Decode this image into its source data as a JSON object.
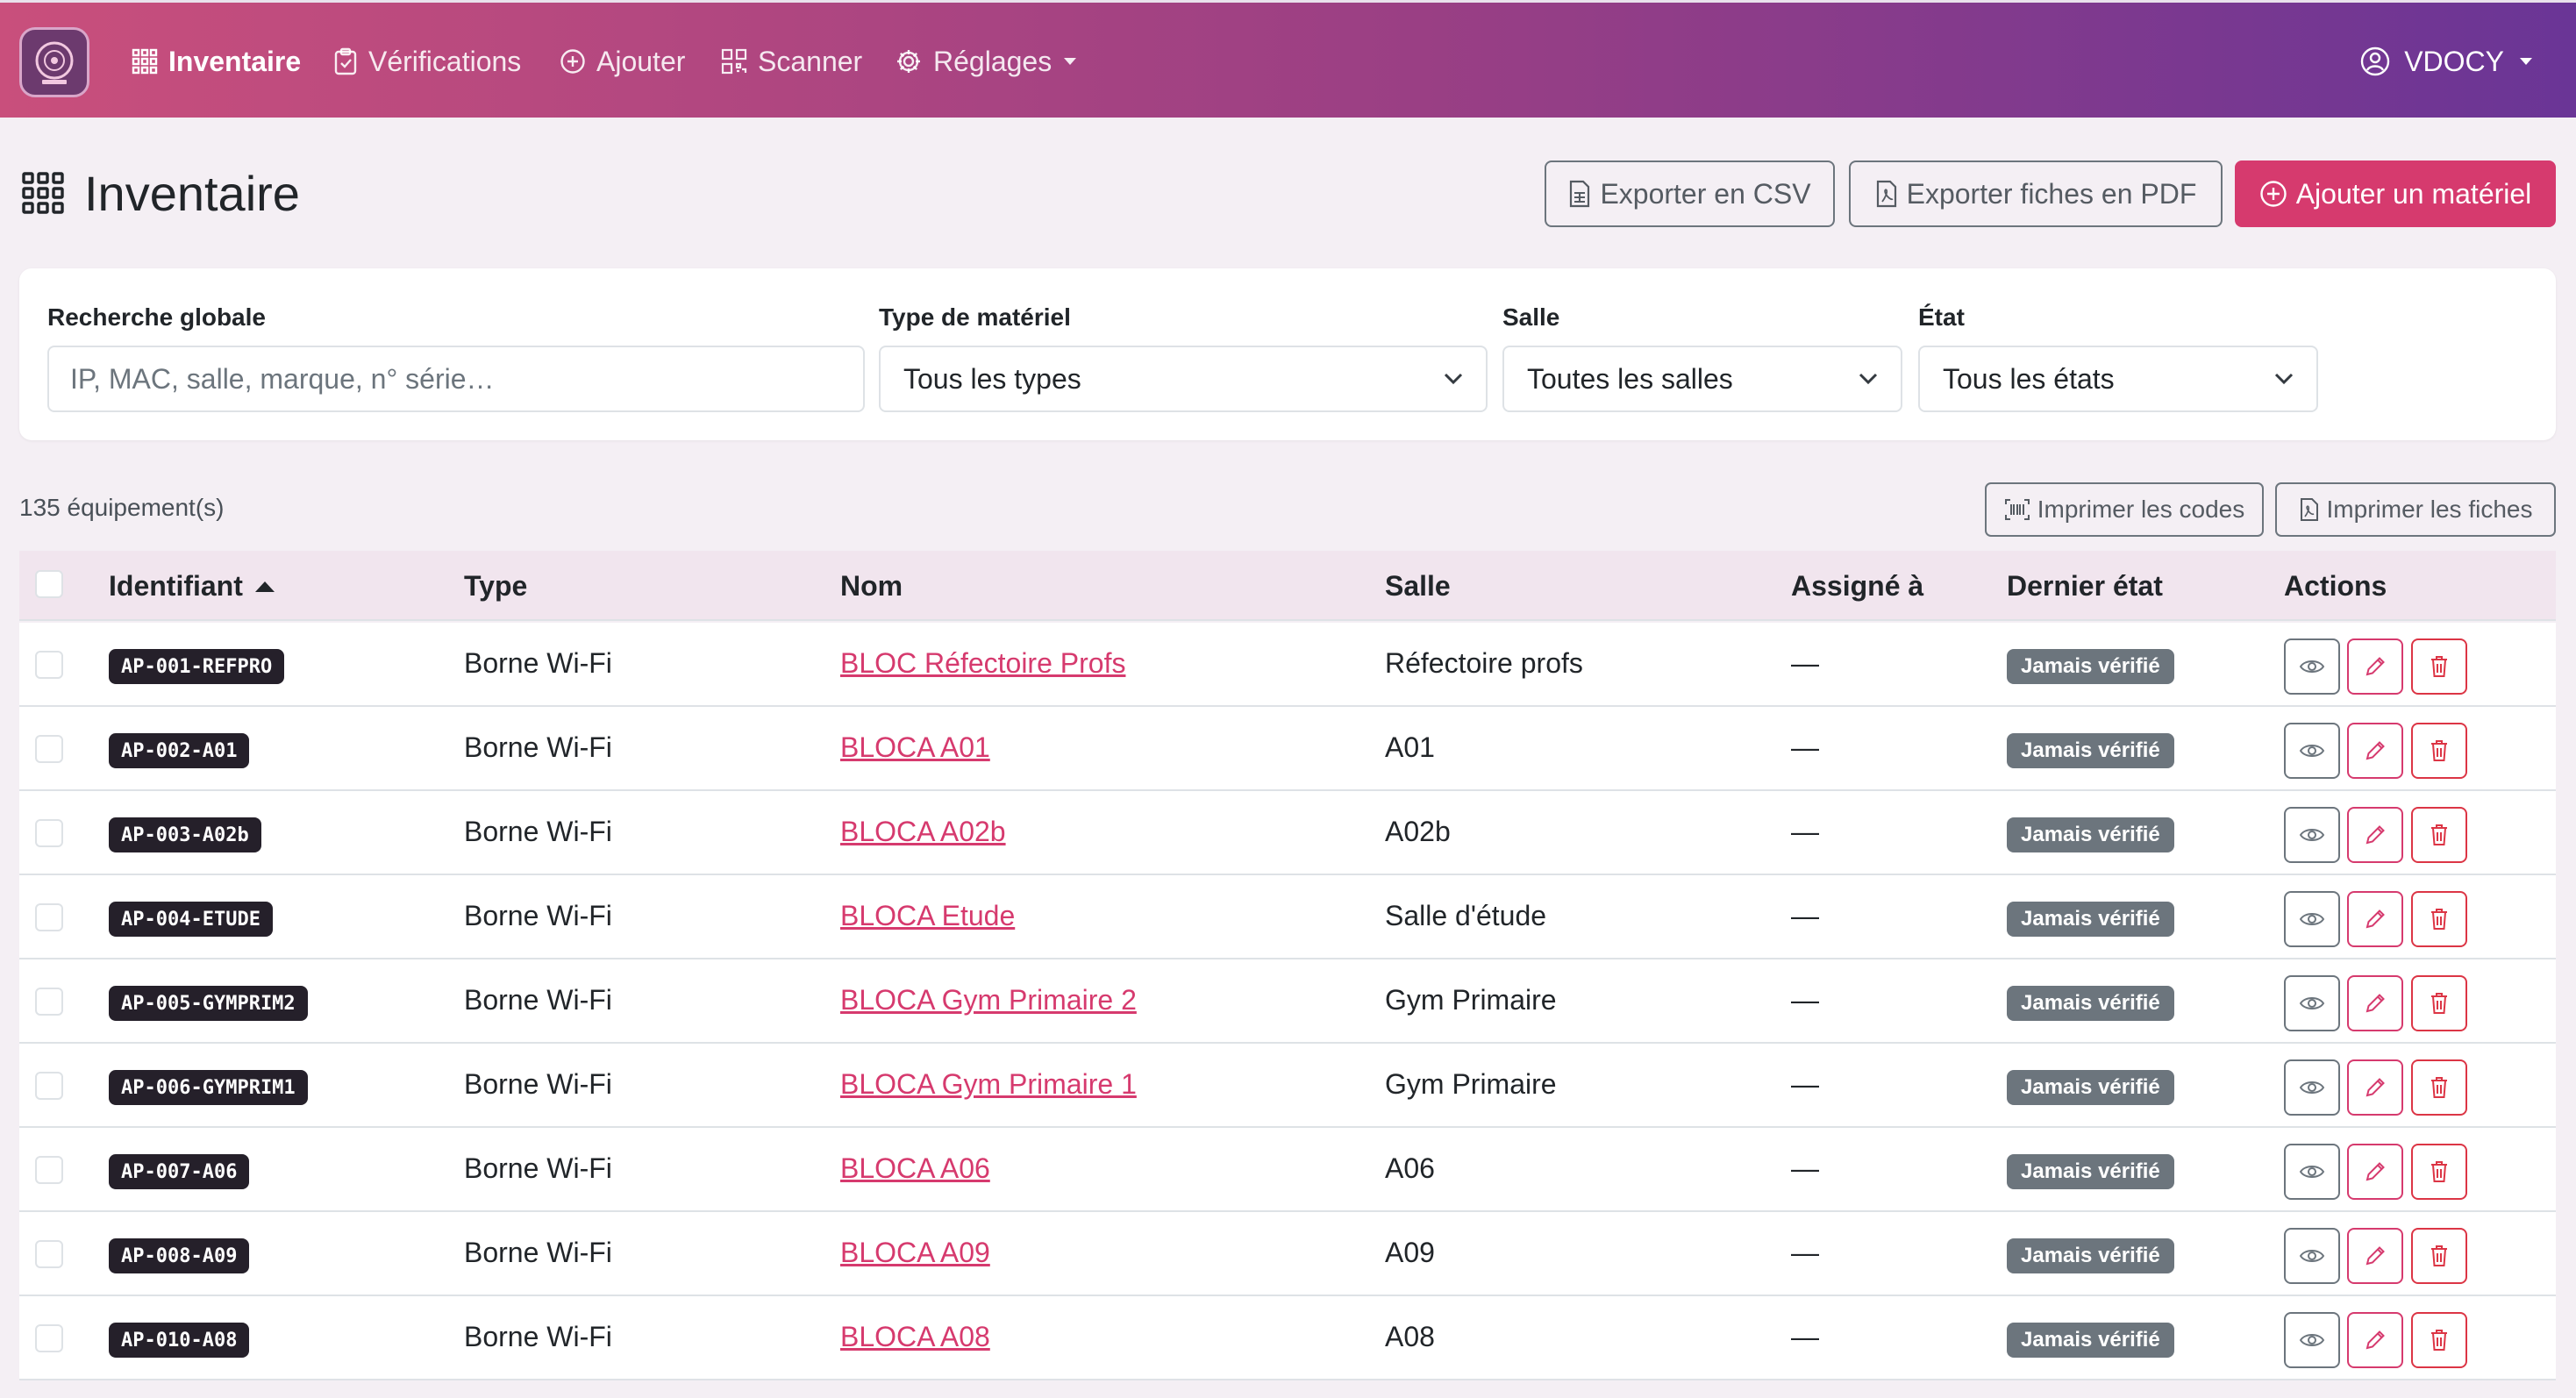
{
  "navbar": {
    "logo_alt": "EQUIPAUL",
    "items": [
      {
        "label": "Inventaire",
        "icon": "grid-icon",
        "active": true
      },
      {
        "label": "Vérifications",
        "icon": "clipboard-check-icon"
      },
      {
        "label": "Ajouter",
        "icon": "plus-circle-icon"
      },
      {
        "label": "Scanner",
        "icon": "qr-code-icon"
      },
      {
        "label": "Réglages",
        "icon": "gear-icon"
      }
    ],
    "user": "VDOCY"
  },
  "page": {
    "title": "Inventaire",
    "export_csv": "Exporter en CSV",
    "export_pdf": "Exporter fiches en PDF",
    "add_material": "Ajouter un matériel"
  },
  "filters": {
    "search_label": "Recherche globale",
    "search_placeholder": "IP, MAC, salle, marque, n° série…",
    "type_label": "Type de matériel",
    "type_value": "Tous les types",
    "room_label": "Salle",
    "room_value": "Toutes les salles",
    "state_label": "État",
    "state_value": "Tous les états"
  },
  "list": {
    "count": "135 équipement(s)",
    "print_codes": "Imprimer les codes",
    "print_sheets": "Imprimer les fiches"
  },
  "table": {
    "columns": {
      "id": "Identifiant",
      "type": "Type",
      "name": "Nom",
      "room": "Salle",
      "assigned": "Assigné à",
      "state": "Dernier état",
      "actions": "Actions"
    },
    "rows": [
      {
        "id": "AP-001-REFPRO",
        "type": "Borne Wi-Fi",
        "name": "BLOC Réfectoire Profs",
        "room": "Réfectoire profs",
        "assigned": "—",
        "state": "Jamais vérifié"
      },
      {
        "id": "AP-002-A01",
        "type": "Borne Wi-Fi",
        "name": "BLOCA A01",
        "room": "A01",
        "assigned": "—",
        "state": "Jamais vérifié"
      },
      {
        "id": "AP-003-A02b",
        "type": "Borne Wi-Fi",
        "name": "BLOCA A02b",
        "room": "A02b",
        "assigned": "—",
        "state": "Jamais vérifié"
      },
      {
        "id": "AP-004-ETUDE",
        "type": "Borne Wi-Fi",
        "name": "BLOCA Etude",
        "room": "Salle d'étude",
        "assigned": "—",
        "state": "Jamais vérifié"
      },
      {
        "id": "AP-005-GYMPRIM2",
        "type": "Borne Wi-Fi",
        "name": "BLOCA Gym Primaire 2",
        "room": "Gym Primaire",
        "assigned": "—",
        "state": "Jamais vérifié"
      },
      {
        "id": "AP-006-GYMPRIM1",
        "type": "Borne Wi-Fi",
        "name": "BLOCA Gym Primaire 1",
        "room": "Gym Primaire",
        "assigned": "—",
        "state": "Jamais vérifié"
      },
      {
        "id": "AP-007-A06",
        "type": "Borne Wi-Fi",
        "name": "BLOCA A06",
        "room": "A06",
        "assigned": "—",
        "state": "Jamais vérifié"
      },
      {
        "id": "AP-008-A09",
        "type": "Borne Wi-Fi",
        "name": "BLOCA A09",
        "room": "A09",
        "assigned": "—",
        "state": "Jamais vérifié"
      },
      {
        "id": "AP-010-A08",
        "type": "Borne Wi-Fi",
        "name": "BLOCA A08",
        "room": "A08",
        "assigned": "—",
        "state": "Jamais vérifié"
      }
    ]
  },
  "colors": {
    "brand": "#d63a6e",
    "navbar_start": "#c94f7c",
    "navbar_end": "#6a3596",
    "badge_dark": "#25202a",
    "badge_state": "#6c757d"
  }
}
